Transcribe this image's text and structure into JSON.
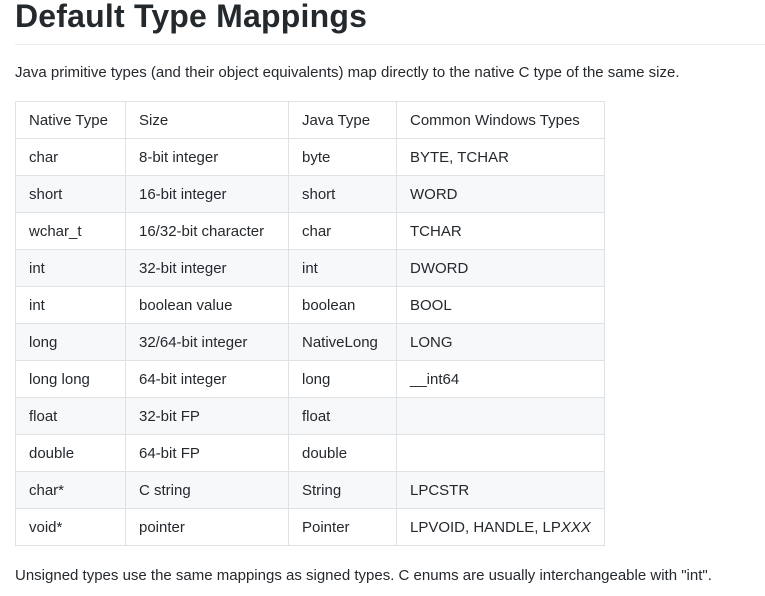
{
  "title": "Default Type Mappings",
  "intro": "Java primitive types (and their object equivalents) map directly to the native C type of the same size.",
  "table": {
    "headers": [
      "Native Type",
      "Size",
      "Java Type",
      "Common Windows Types"
    ],
    "rows": [
      [
        "char",
        "8-bit integer",
        "byte",
        "BYTE, TCHAR"
      ],
      [
        "short",
        "16-bit integer",
        "short",
        "WORD"
      ],
      [
        "wchar_t",
        "16/32-bit character",
        "char",
        "TCHAR"
      ],
      [
        "int",
        "32-bit integer",
        "int",
        "DWORD"
      ],
      [
        "int",
        "boolean value",
        "boolean",
        "BOOL"
      ],
      [
        "long",
        "32/64-bit integer",
        "NativeLong",
        "LONG"
      ],
      [
        "long long",
        "64-bit integer",
        "long",
        "__int64"
      ],
      [
        "float",
        "32-bit FP",
        "float",
        ""
      ],
      [
        "double",
        "64-bit FP",
        "double",
        ""
      ],
      [
        "char*",
        "C string",
        "String",
        "LPCSTR"
      ],
      [
        "void*",
        "pointer",
        "Pointer",
        "LPVOID, HANDLE, LP"
      ]
    ],
    "last_row_windows_suffix": "XXX"
  },
  "footer": "Unsigned types use the same mappings as signed types. C enums are usually interchangeable with \"int\"."
}
